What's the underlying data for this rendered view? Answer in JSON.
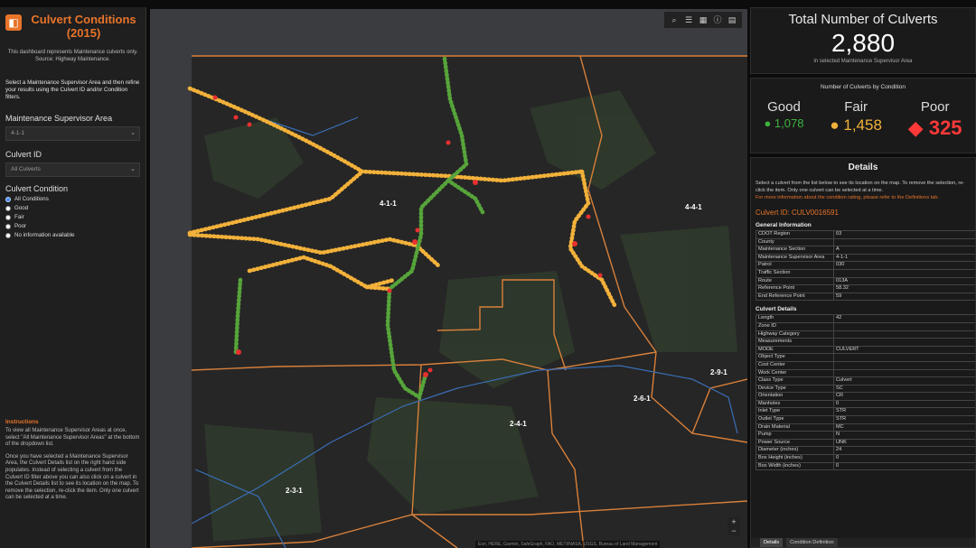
{
  "sidebar": {
    "title": "Culvert Conditions (2015)",
    "intro": "This dashboard represents Maintenance culverts only. Source: Highway Maintenance.",
    "instructions": "Select a Maintenance Supervisor Area and then refine your results using the Culvert ID and/or Condition filters.",
    "area_label": "Maintenance Supervisor Area",
    "area_value": "4-1-1",
    "culvert_id_label": "Culvert ID",
    "culvert_id_value": "All Culverts",
    "condition_label": "Culvert Condition",
    "conditions": [
      "All Conditions",
      "Good",
      "Fair",
      "Poor",
      "No information available"
    ],
    "notes_heading": "Instructions",
    "notes": [
      "To view all Maintenance Supervisor Areas at once, select \"All Maintenance Supervisor Areas\" at the bottom of the dropdown list.",
      "Once you have selected a Maintenance Supervisor Area, the Culvert Details list on the right hand side populates. Instead of selecting a culvert from the Culvert ID filter above you can also click on a culvert in the Culvert Details list to see its location on the map. To remove the selection, re-click the item. Only one culvert can be selected at a time."
    ]
  },
  "map": {
    "labels": [
      "4-1-1",
      "4-4-1",
      "2-9-1",
      "2-6-1",
      "2-4-1",
      "2-3-1"
    ],
    "attribution": "Esri, HERE, Garmin, SafeGraph, FAO, METI/NASA, USGS, Bureau of Land Management"
  },
  "total": {
    "heading": "Total Number of Culverts",
    "value": "2,880",
    "subtitle": "in selected Maintenance Supervisor Area"
  },
  "by_condition": {
    "heading": "Number of Culverts by Condition",
    "good_label": "Good",
    "good_value": "1,078",
    "fair_label": "Fair",
    "fair_value": "1,458",
    "poor_label": "Poor",
    "poor_value": "325"
  },
  "details": {
    "heading": "Details",
    "instructions": "Select a culvert from the list below to see its location on the map. To remove the selection, re-click the item. Only one culvert can be selected at a time.",
    "more_info": "For more information about the condition rating, please refer to the Definitions tab.",
    "culvert_id_label": "Culvert ID:",
    "culvert_id_value": "CULV0016591",
    "general_heading": "General Information",
    "general_rows": [
      [
        "CDOT Region",
        "03"
      ],
      [
        "County",
        ""
      ],
      [
        "Maintenance Section",
        "A"
      ],
      [
        "Maintenance Supervisor Area",
        "4-1-1"
      ],
      [
        "Patrol",
        "030"
      ],
      [
        "Traffic Section",
        ""
      ],
      [
        "Route",
        "013A"
      ],
      [
        "Reference Point",
        "58.32"
      ],
      [
        "End Reference Point",
        "59"
      ]
    ],
    "details_heading": "Culvert Details",
    "detail_rows": [
      [
        "Length",
        "42"
      ],
      [
        "Zone ID",
        ""
      ],
      [
        "Highway Category",
        ""
      ],
      [
        "Measurements",
        ""
      ],
      [
        "MODE",
        "CULVERT"
      ],
      [
        "Object Type",
        ""
      ],
      [
        "Cost Center",
        ""
      ],
      [
        "Work Center",
        ""
      ],
      [
        "Class Type",
        "Culvert"
      ],
      [
        "Device Type",
        "SC"
      ],
      [
        "Orientation",
        "CR"
      ],
      [
        "Manholes",
        "0"
      ],
      [
        "Inlet Type",
        "STR"
      ],
      [
        "Outlet Type",
        "STR"
      ],
      [
        "Drain Material",
        "MC"
      ],
      [
        "Pump",
        "N"
      ],
      [
        "Power Source",
        "UNK"
      ],
      [
        "Diameter (inches)",
        "24"
      ],
      [
        "Box Height (inches)",
        "0"
      ],
      [
        "Box Width (inches)",
        "0"
      ]
    ],
    "tabs": [
      "Details",
      "Condition Definition"
    ]
  },
  "colors": {
    "accent": "#e8742a",
    "good": "#3fb23f",
    "fair": "#f2b13a",
    "poor": "#ff3838"
  }
}
